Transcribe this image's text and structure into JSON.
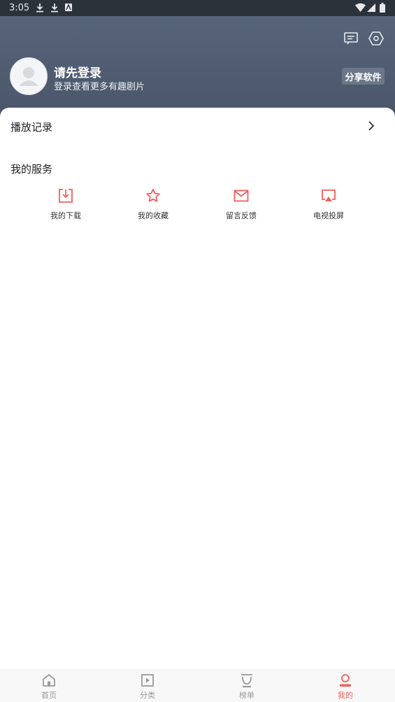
{
  "status_bar": {
    "time": "3:05"
  },
  "header": {
    "title": "请先登录",
    "subtitle": "登录查看更多有趣剧片",
    "share_label": "分享软件"
  },
  "history": {
    "label": "播放记录"
  },
  "services": {
    "title": "我的服务",
    "items": [
      {
        "label": "我的下载",
        "icon": "download-icon"
      },
      {
        "label": "我的收藏",
        "icon": "star-icon"
      },
      {
        "label": "留言反馈",
        "icon": "mail-icon"
      },
      {
        "label": "电视投屏",
        "icon": "cast-icon"
      }
    ]
  },
  "tabs": [
    {
      "label": "首页",
      "icon": "home-icon",
      "active": false
    },
    {
      "label": "分类",
      "icon": "category-icon",
      "active": false
    },
    {
      "label": "榜单",
      "icon": "ranking-icon",
      "active": false
    },
    {
      "label": "我的",
      "icon": "profile-icon",
      "active": true
    }
  ],
  "colors": {
    "accent": "#ef5f5c",
    "header": "#525f74"
  }
}
